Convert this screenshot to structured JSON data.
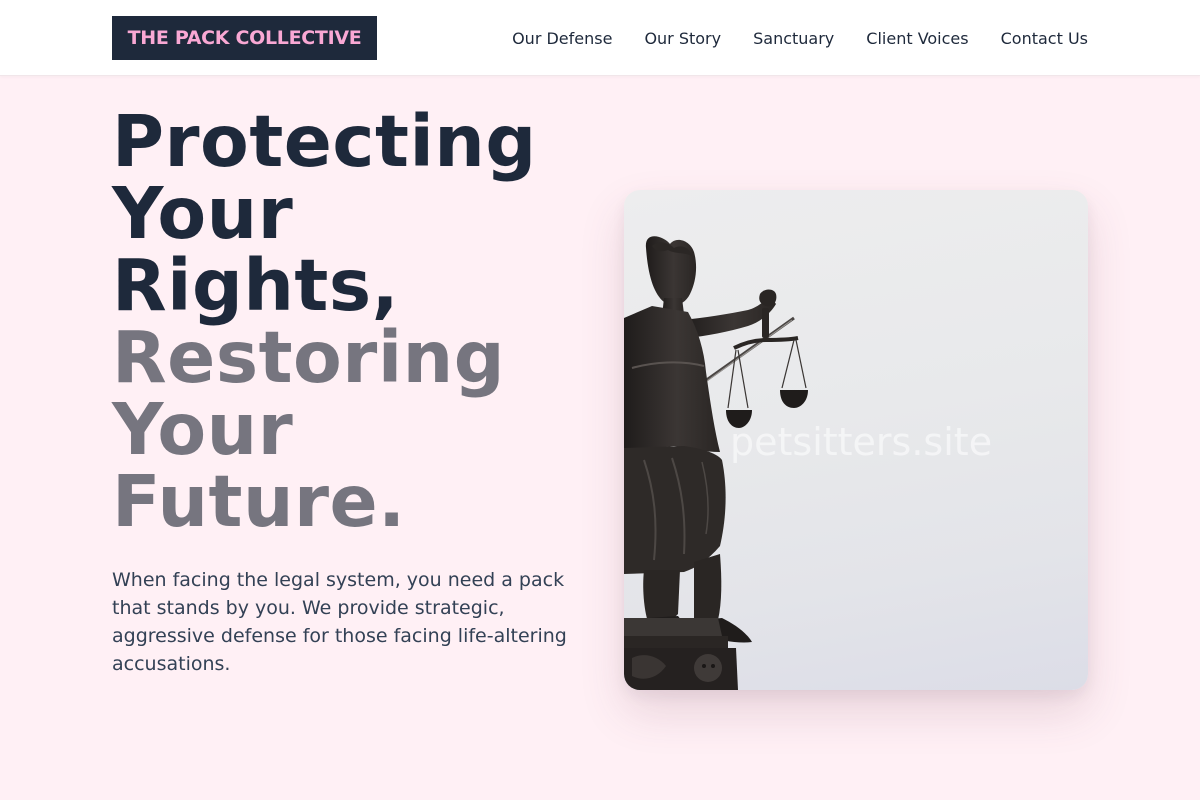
{
  "brand": {
    "name": "THE PACK COLLECTIVE"
  },
  "nav": {
    "items": [
      {
        "label": "Our Defense"
      },
      {
        "label": "Our Story"
      },
      {
        "label": "Sanctuary"
      },
      {
        "label": "Client Voices"
      },
      {
        "label": "Contact Us"
      }
    ]
  },
  "hero": {
    "heading_lines": [
      {
        "text": "Protecting",
        "tone": "dark"
      },
      {
        "text": "Your",
        "tone": "dark"
      },
      {
        "text": "Rights,",
        "tone": "dark"
      },
      {
        "text": "Restoring",
        "tone": "muted"
      },
      {
        "text": "Your",
        "tone": "muted"
      },
      {
        "text": "Future.",
        "tone": "muted"
      }
    ],
    "body": "When facing the legal system, you need a pack that stands by you. We provide strategic, aggressive defense for those facing life-altering accusations.",
    "image_watermark": "petsitters.site"
  },
  "colors": {
    "page_background": "#fff0f5",
    "header_background": "#ffffff",
    "brand_dark": "#1e293b",
    "brand_pink": "#f9a8d4",
    "heading_muted": "#76757f",
    "body_text": "#334155"
  },
  "icons": {
    "hero_image": "lady-justice-statue-photo"
  }
}
